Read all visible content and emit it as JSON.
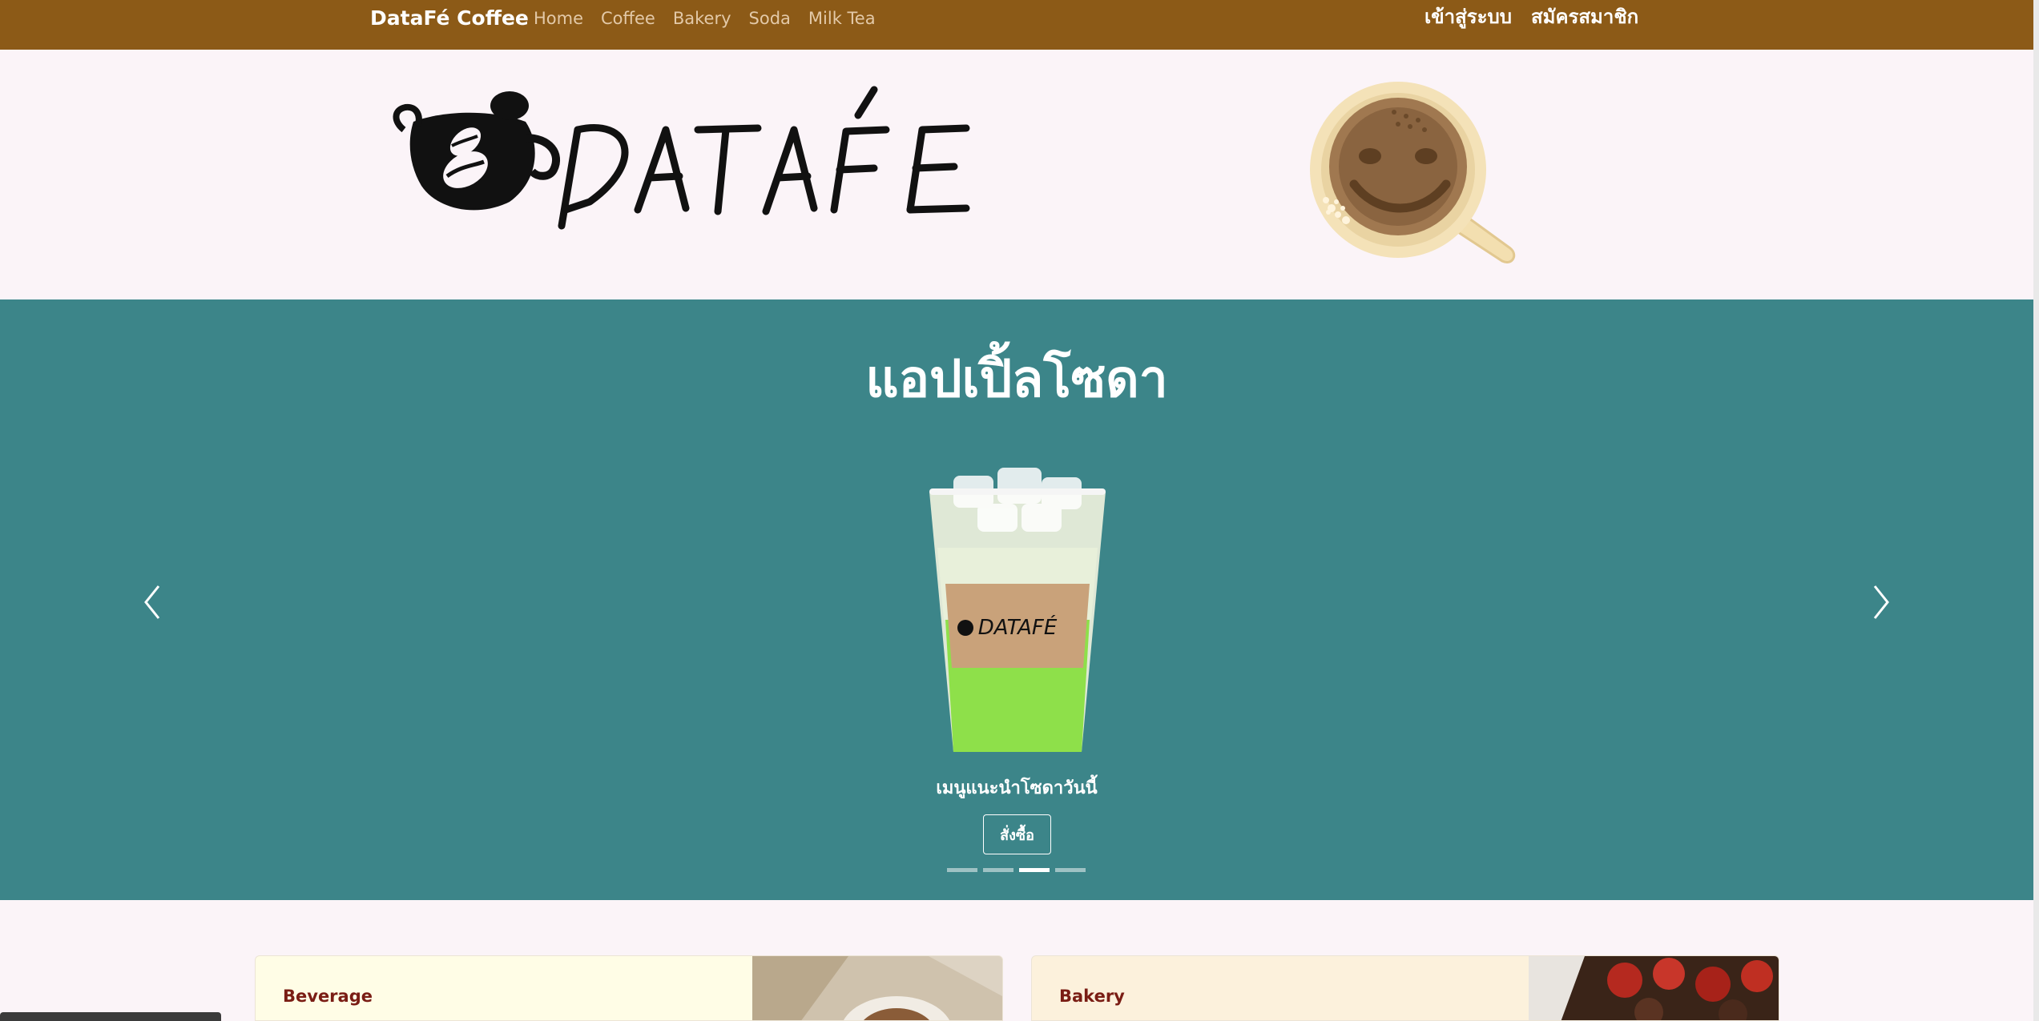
{
  "navbar": {
    "brand": "DataFé Coffee",
    "links": [
      "Home",
      "Coffee",
      "Bakery",
      "Soda",
      "Milk Tea"
    ],
    "login": "เข้าสู่ระบบ",
    "register": "สมัครสมาชิก",
    "color": "#8c5a17"
  },
  "header": {
    "logo_icon": "dataFe-logo",
    "cup_icon": "smiley-coffee-cup-icon"
  },
  "carousel": {
    "title": "แอปเปิ้ลโซดา",
    "caption": "เมนูแนะนำโซดาวันนี้",
    "button": "สั่งซื้อ",
    "slide_count": 4,
    "active_slide": 3,
    "background": "#3c8589",
    "image": "apple-soda-cup"
  },
  "cards": [
    {
      "label": "Beverage",
      "image": "latte-cup-photo",
      "background": "#fffde6"
    },
    {
      "label": "Bakery",
      "image": "chocolate-strawberry-cake-photo",
      "background": "#fcf1dc"
    }
  ]
}
